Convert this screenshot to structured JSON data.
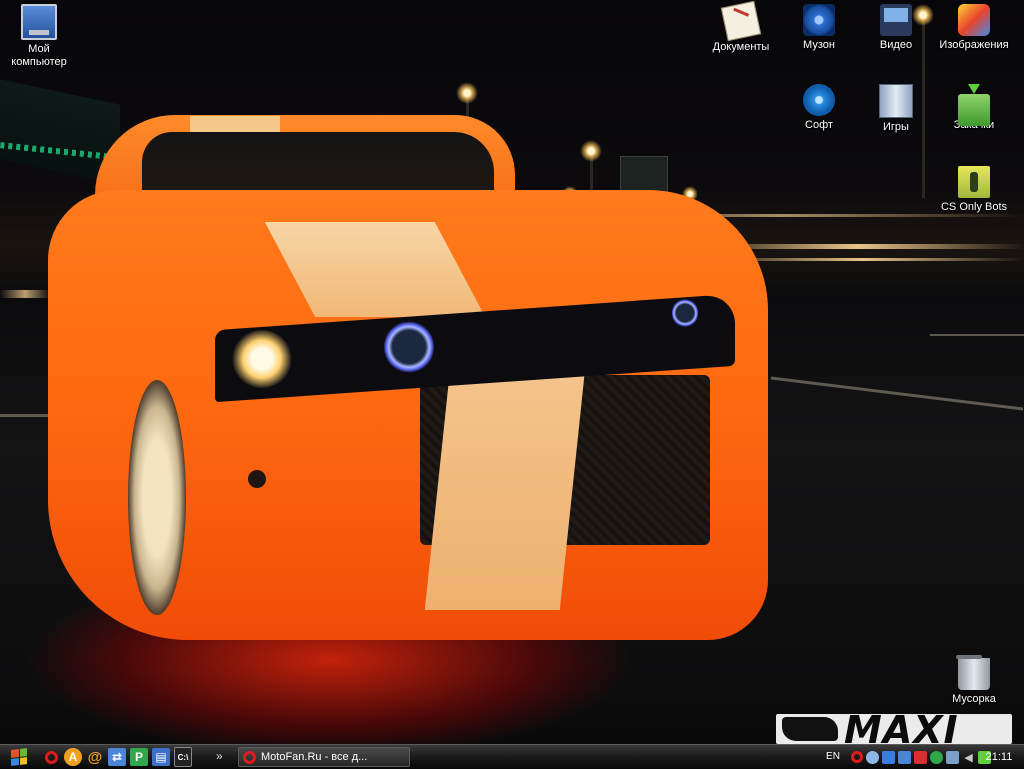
{
  "desktop": {
    "icons": [
      {
        "id": "my-computer",
        "label": "Мой компьютер",
        "icon": "computer-icon"
      },
      {
        "id": "documents",
        "label": "Документы",
        "icon": "documents-icon"
      },
      {
        "id": "music",
        "label": "Музон",
        "icon": "music-icon"
      },
      {
        "id": "video",
        "label": "Видео",
        "icon": "video-icon"
      },
      {
        "id": "images",
        "label": "Изображения",
        "icon": "images-icon"
      },
      {
        "id": "software",
        "label": "Софт",
        "icon": "software-icon"
      },
      {
        "id": "games",
        "label": "Игры",
        "icon": "games-icon"
      },
      {
        "id": "downloads",
        "label": "Закачки",
        "icon": "downloads-icon"
      },
      {
        "id": "cs-bots",
        "label": "CS Only Bots",
        "icon": "cs-icon"
      },
      {
        "id": "recycle-bin",
        "label": "Мусорка",
        "icon": "recycle-bin-icon"
      }
    ]
  },
  "wallpaper": {
    "logo_text": "MAXI"
  },
  "taskbar": {
    "start_icon": "windows-flag-icon",
    "quick_launch": [
      {
        "name": "opera-icon",
        "glyph": "O",
        "color": "#e01b1b"
      },
      {
        "name": "aimp-icon",
        "glyph": "A",
        "color": "#f0a020"
      },
      {
        "name": "email-icon",
        "glyph": "@",
        "color": "#f0a020"
      },
      {
        "name": "network-icon",
        "glyph": "⇄",
        "color": "#4a86d8"
      },
      {
        "name": "messenger-icon",
        "glyph": "P",
        "color": "#2fa84a"
      },
      {
        "name": "document-icon",
        "glyph": "▤",
        "color": "#3c6fc8"
      },
      {
        "name": "command-prompt-icon",
        "glyph": "C:\\",
        "color": "#222222"
      }
    ],
    "overflow_label": "»",
    "active_window": {
      "title": "MotoFan.Ru - все д...",
      "icon": "opera-icon"
    },
    "language": "EN",
    "tray_icons": [
      {
        "name": "opera-tray-icon",
        "color": "#e01b1b"
      },
      {
        "name": "antivirus-tray-icon",
        "color": "#8fb8e8"
      },
      {
        "name": "display-tray-icon",
        "color": "#3a7de0"
      },
      {
        "name": "windows-tray-icon",
        "color": "#4a86d8"
      },
      {
        "name": "network-warning-tray-icon",
        "color": "#d83030"
      },
      {
        "name": "messenger-tray-icon",
        "color": "#2fa84a"
      },
      {
        "name": "safely-remove-tray-icon",
        "color": "#7aa0c8"
      },
      {
        "name": "volume-tray-icon",
        "color": "#c8c8c8"
      },
      {
        "name": "connection-tray-icon",
        "color": "#5fd03a"
      }
    ],
    "clock": "21:11"
  }
}
